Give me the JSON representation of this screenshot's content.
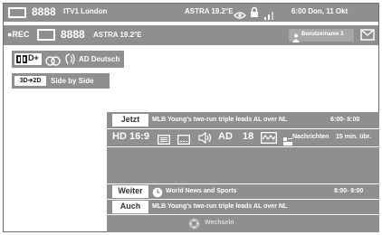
{
  "top_bar": {
    "channel_number": "8888",
    "channel_name": "ITV1 London",
    "satellite": "ASTRA 19.2°E",
    "time_date": "6:00 Don, 11 Okt",
    "icons": [
      "screen-icon",
      "signal-eye-icon",
      "lock-icon",
      "signal-strength-icon"
    ]
  },
  "rec_bar": {
    "rec_label": "●REC",
    "channel_number": "8888",
    "satellite": "ASTRA 19.2°E",
    "user_label": "Benutzername 3",
    "icons": [
      "screen-icon",
      "user-icon",
      "mail-icon"
    ]
  },
  "audio_bar": {
    "dolby_label": "D+",
    "audio_label": "AD Deutsch",
    "icons": [
      "dolby-icon",
      "stereo-icon",
      "audio-description-icon"
    ]
  },
  "mode_bar": {
    "mode_chip": "3D➔2D",
    "mode_label": "Side by Side"
  },
  "now": {
    "label": "Jetzt",
    "title": "MLB Young's two-run triple leads AL over NL",
    "time": "6:00- 8:00"
  },
  "features": {
    "hd": "HD",
    "aspect": "16:9",
    "ad": "AD",
    "age": "18",
    "genre": "Nachrichten",
    "remaining": "15 min. übr.",
    "icons": [
      "teletext-icon",
      "subtitle-icon",
      "audio-icon",
      "waveform-icon",
      "news-icon"
    ]
  },
  "next": {
    "label": "Weiter",
    "title": "World News and Sports",
    "time": "8:00- 9:00",
    "icons": [
      "clock-icon"
    ]
  },
  "also": {
    "label": "Auch",
    "title": "MLB Young's two-run triple leads AL over NL"
  },
  "footer": {
    "switch_label": "Wechseln",
    "icons": [
      "nav-button-icon"
    ]
  }
}
